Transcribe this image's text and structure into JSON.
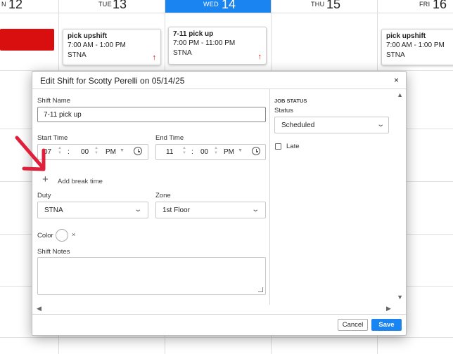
{
  "calendar": {
    "days": [
      {
        "name": "N",
        "num": "12"
      },
      {
        "name": "TUE",
        "num": "13"
      },
      {
        "name": "WED",
        "num": "14"
      },
      {
        "name": "THU",
        "num": "15"
      },
      {
        "name": "FRI",
        "num": "16"
      }
    ],
    "today_color": "#1a84f0",
    "cards": [
      {
        "title": "pick upshift",
        "time": "7:00 AM - 1:00 PM",
        "duty": "STNA"
      },
      {
        "title": "7-11 pick up",
        "time": "7:00 PM - 11:00 PM",
        "duty": "STNA"
      },
      {
        "title": "pick upshift",
        "time": "7:00 AM - 1:00 PM",
        "duty": "STNA"
      }
    ],
    "shift_block_color": "#d90f0f"
  },
  "modal": {
    "title": "Edit Shift for Scotty Perelli on 05/14/25",
    "close_icon": "×",
    "shift_name": {
      "label": "Shift Name",
      "value": "7-11 pick up"
    },
    "start_time": {
      "label": "Start Time",
      "hour": "07",
      "minute": "00",
      "ampm": "PM"
    },
    "end_time": {
      "label": "End Time",
      "hour": "11",
      "minute": "00",
      "ampm": "PM"
    },
    "add_break": {
      "icon": "+",
      "label": "Add break time"
    },
    "duty": {
      "label": "Duty",
      "value": "STNA"
    },
    "zone": {
      "label": "Zone",
      "value": "1st Floor"
    },
    "color": {
      "label": "Color",
      "clear": "×"
    },
    "notes": {
      "label": "Shift Notes",
      "value": ""
    },
    "job_status": {
      "heading": "JOB STATUS",
      "status_label": "Status",
      "status_value": "Scheduled",
      "late_label": "Late"
    },
    "buttons": {
      "cancel": "Cancel",
      "save": "Save"
    },
    "accent_color": "#1a84f0",
    "annotation_arrow_color": "#e0203a"
  }
}
